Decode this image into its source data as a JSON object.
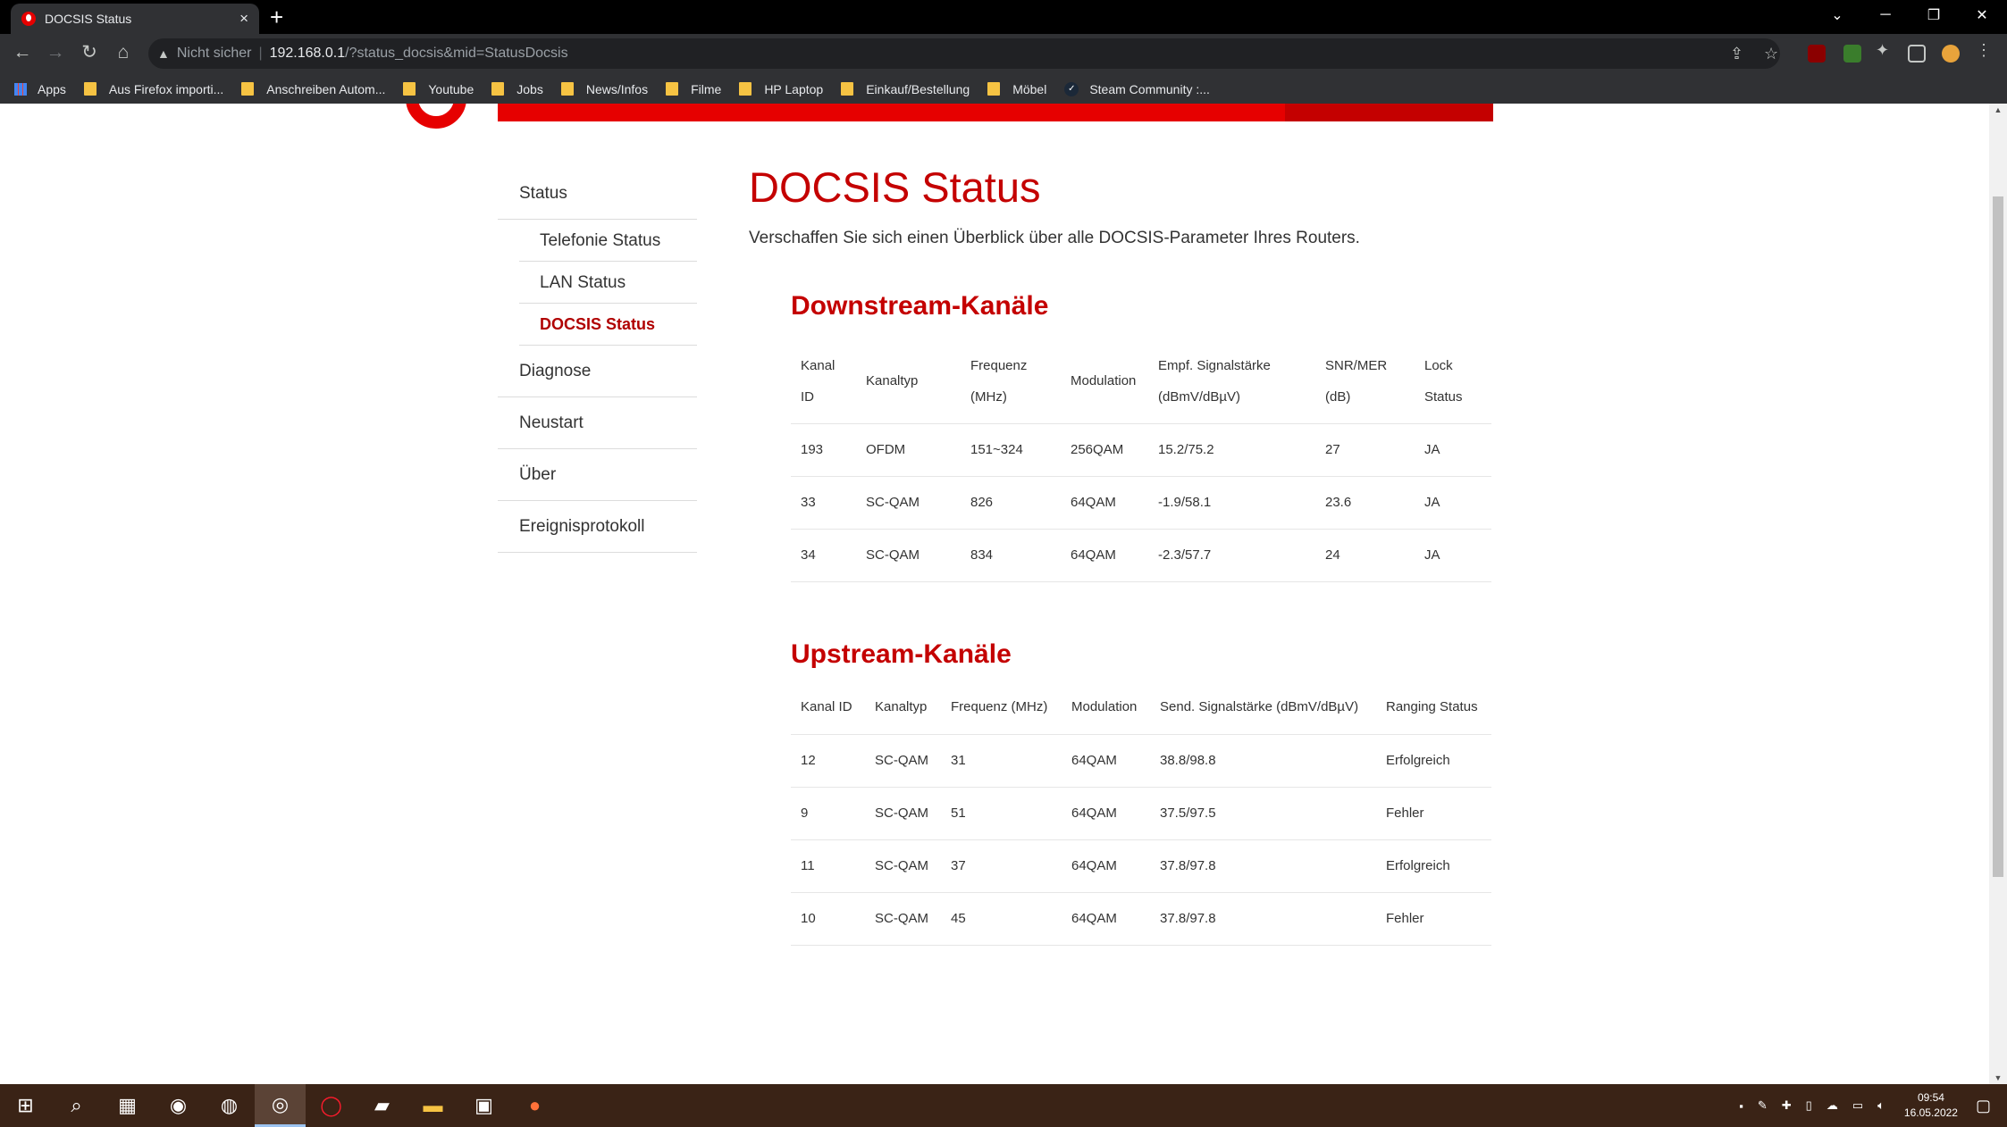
{
  "browser": {
    "tab_title": "DOCSIS Status",
    "tab_close": "×",
    "new_tab": "+",
    "security_label": "Nicht sicher",
    "url_host": "192.168.0.1",
    "url_path": "/?status_docsis&mid=StatusDocsis",
    "bookmarks": [
      "Apps",
      "Aus Firefox importi...",
      "Anschreiben Autom...",
      "Youtube",
      "Jobs",
      "News/Infos",
      "Filme",
      "HP Laptop",
      "Einkauf/Bestellung",
      "Möbel",
      "Steam Community :..."
    ]
  },
  "sidebar": {
    "status": "Status",
    "telefonie": "Telefonie Status",
    "lan": "LAN Status",
    "docsis": "DOCSIS Status",
    "diagnose": "Diagnose",
    "neustart": "Neustart",
    "ueber": "Über",
    "ereignis": "Ereignisprotokoll"
  },
  "main": {
    "title": "DOCSIS Status",
    "intro": "Verschaffen Sie sich einen Überblick über alle DOCSIS-Parameter Ihres Routers."
  },
  "downstream": {
    "title": "Downstream-Kanäle",
    "headers": [
      "Kanal ID",
      "Kanaltyp",
      "Frequenz (MHz)",
      "Modulation",
      "Empf. Signalstärke (dBmV/dBµV)",
      "SNR/MER (dB)",
      "Lock Status"
    ],
    "rows": [
      [
        "193",
        "OFDM",
        "151~324",
        "256QAM",
        "15.2/75.2",
        "27",
        "JA"
      ],
      [
        "33",
        "SC-QAM",
        "826",
        "64QAM",
        "-1.9/58.1",
        "23.6",
        "JA"
      ],
      [
        "34",
        "SC-QAM",
        "834",
        "64QAM",
        "-2.3/57.7",
        "24",
        "JA"
      ]
    ]
  },
  "upstream": {
    "title": "Upstream-Kanäle",
    "headers": [
      "Kanal ID",
      "Kanaltyp",
      "Frequenz (MHz)",
      "Modulation",
      "Send. Signalstärke (dBmV/dBµV)",
      "Ranging Status"
    ],
    "rows": [
      [
        "12",
        "SC-QAM",
        "31",
        "64QAM",
        "38.8/98.8",
        "Erfolgreich"
      ],
      [
        "9",
        "SC-QAM",
        "51",
        "64QAM",
        "37.5/97.5",
        "Fehler"
      ],
      [
        "11",
        "SC-QAM",
        "37",
        "64QAM",
        "37.8/97.8",
        "Erfolgreich"
      ],
      [
        "10",
        "SC-QAM",
        "45",
        "64QAM",
        "37.8/97.8",
        "Fehler"
      ]
    ]
  },
  "taskbar": {
    "time": "09:54",
    "date": "16.05.2022"
  },
  "colors": {
    "accent": "#e60000",
    "heading": "#c40000"
  }
}
